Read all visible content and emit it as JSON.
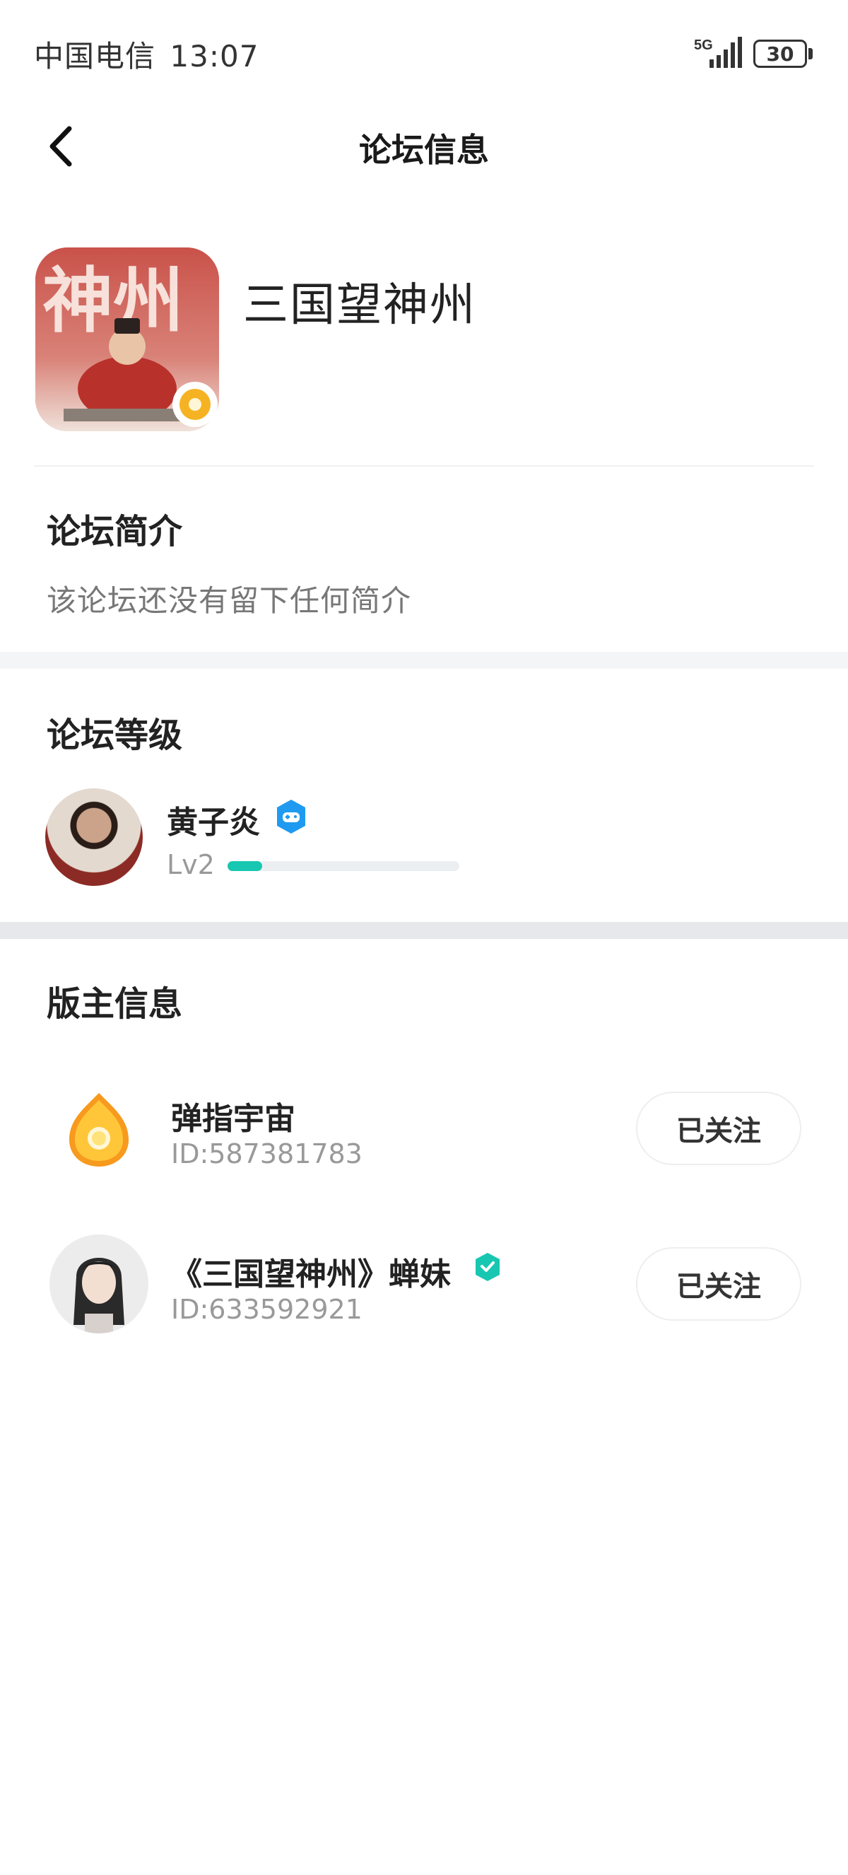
{
  "status_bar": {
    "carrier": "中国电信",
    "time": "13:07",
    "network": "5G",
    "battery": "30"
  },
  "nav": {
    "back_icon": "chevron-left-icon",
    "title": "论坛信息"
  },
  "forum": {
    "name": "三国望神州",
    "logo_text": "神州",
    "badge_icon": "gold-coin-icon"
  },
  "intro": {
    "title": "论坛简介",
    "text": "该论坛还没有留下任何简介"
  },
  "level": {
    "title": "论坛等级",
    "user_name": "黄子炎",
    "badge_icon": "gamepad-shield-icon",
    "level_label": "Lv2",
    "progress": 0.15
  },
  "moderators": {
    "title": "版主信息",
    "items": [
      {
        "name": "弹指宇宙",
        "id": "ID:587381783",
        "follow_label": "已关注",
        "avatar_icon": "orange-coin-avatar"
      },
      {
        "name": "《三国望神州》蝉妹",
        "id": "ID:633592921",
        "follow_label": "已关注",
        "avatar_icon": "lady-portrait-avatar",
        "verified_icon": "verified-check-icon"
      }
    ]
  },
  "colors": {
    "accent": "#17c7b1",
    "badge_blue": "#1e9bf0",
    "separator": "#f4f5f7"
  }
}
